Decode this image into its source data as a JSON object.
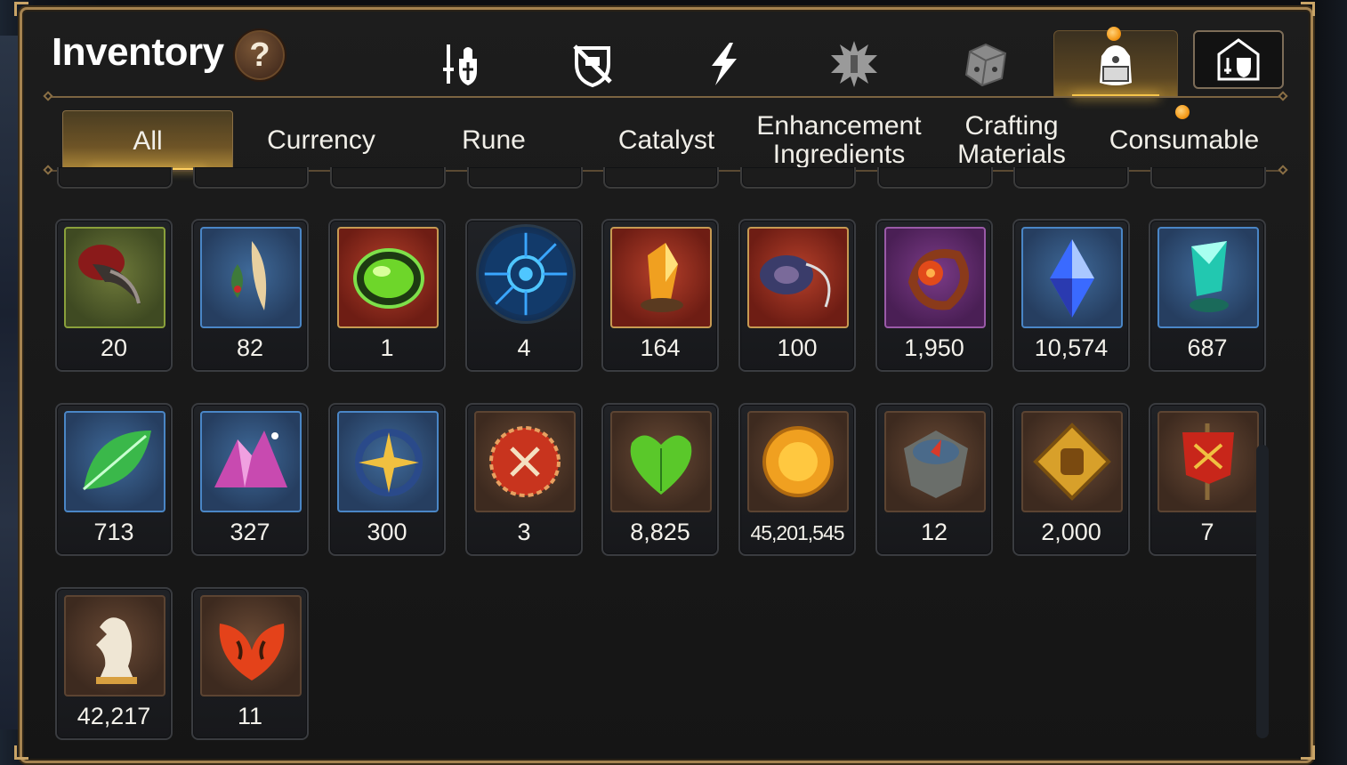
{
  "header": {
    "title": "Inventory",
    "help_label": "?"
  },
  "category_tabs": [
    {
      "icon": "sword-shield-icon",
      "active": false
    },
    {
      "icon": "shield-crossed-icon",
      "active": false
    },
    {
      "icon": "lightning-icon",
      "active": false
    },
    {
      "icon": "burst-emblem-icon",
      "active": false
    },
    {
      "icon": "die-icon",
      "active": false
    },
    {
      "icon": "backpack-icon",
      "active": true,
      "notification": true
    },
    {
      "icon": "gear-set-icon",
      "active": false
    }
  ],
  "sub_tabs": [
    {
      "label": "All",
      "active": true
    },
    {
      "label": "Currency"
    },
    {
      "label": "Rune"
    },
    {
      "label": "Catalyst"
    },
    {
      "label": "Enhancement Ingredients"
    },
    {
      "label": "Crafting Materials"
    },
    {
      "label": "Consumable",
      "notification": true
    }
  ],
  "items": [
    {
      "icon": "claw-icon",
      "qty": "20",
      "bg": "green"
    },
    {
      "icon": "feather-herb-icon",
      "qty": "82",
      "bg": "blue"
    },
    {
      "icon": "green-orb-icon",
      "qty": "1",
      "bg": "red"
    },
    {
      "icon": "rune-disc-icon",
      "qty": "4",
      "bg": "round"
    },
    {
      "icon": "amber-crystal-icon",
      "qty": "164",
      "bg": "red"
    },
    {
      "icon": "yo-yo-icon",
      "qty": "100",
      "bg": "red"
    },
    {
      "icon": "flower-ring-icon",
      "qty": "1,950",
      "bg": "purple"
    },
    {
      "icon": "blue-gem-icon",
      "qty": "10,574",
      "bg": "blue"
    },
    {
      "icon": "teal-crystal-icon",
      "qty": "687",
      "bg": "blue"
    },
    {
      "icon": "leaf-icon",
      "qty": "713",
      "bg": "blue"
    },
    {
      "icon": "crystal-pile-icon",
      "qty": "327",
      "bg": "blue"
    },
    {
      "icon": "star-pendant-icon",
      "qty": "300",
      "bg": "blue"
    },
    {
      "icon": "crest-badge-icon",
      "qty": "3",
      "bg": "brown"
    },
    {
      "icon": "green-heart-icon",
      "qty": "8,825",
      "bg": "brown"
    },
    {
      "icon": "gold-coin-icon",
      "qty": "45,201,545",
      "bg": "brown"
    },
    {
      "icon": "compass-stone-icon",
      "qty": "12",
      "bg": "brown"
    },
    {
      "icon": "fist-emblem-icon",
      "qty": "2,000",
      "bg": "brown"
    },
    {
      "icon": "war-banner-icon",
      "qty": "7",
      "bg": "brown"
    },
    {
      "icon": "knight-chess-icon",
      "qty": "42,217",
      "bg": "brown"
    },
    {
      "icon": "fire-leaf-icon",
      "qty": "11",
      "bg": "brown"
    }
  ]
}
